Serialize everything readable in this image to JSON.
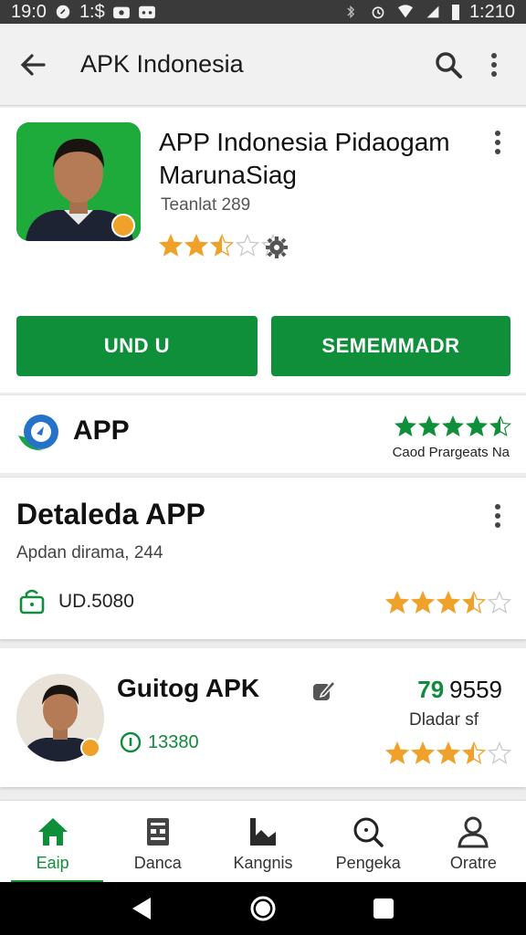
{
  "status_bar": {
    "left_time": "19:0",
    "left_extra": "1:$",
    "right_time": "1:210"
  },
  "app_bar": {
    "title": "APK Indonesia",
    "icons": [
      "back-arrow-icon",
      "search-icon",
      "more-vert-icon"
    ]
  },
  "header": {
    "app_title": "APP Indonesia Pidaogam MarunaSiag",
    "subtitle": "Teanlat 289",
    "rating": 2.5,
    "install_label": "UND U",
    "secondary_label": "SEMEMMADR"
  },
  "app_row": {
    "label": "APP",
    "rating": 4.5,
    "caption": "Caod Prargeats Na"
  },
  "details": {
    "title": "Detaleda APP",
    "subtitle": "Apdan dirama, 244",
    "price": "UD.5080",
    "rating": 3.5
  },
  "listing": {
    "name": "Guitog APK",
    "downloads": "13380",
    "metric_value": "79",
    "metric_suffix": "9559",
    "metric_label": "Dladar sf",
    "rating": 3.5
  },
  "bottom_nav": [
    {
      "label": "Eaip",
      "icon": "home-icon",
      "active": true
    },
    {
      "label": "Danca",
      "icon": "apps-icon",
      "active": false
    },
    {
      "label": "Kangnis",
      "icon": "chart-icon",
      "active": false
    },
    {
      "label": "Pengeka",
      "icon": "search-icon",
      "active": false
    },
    {
      "label": "Oratre",
      "icon": "person-icon",
      "active": false
    }
  ],
  "colors": {
    "accent": "#0f8f3a",
    "star": "#f0a12a",
    "status_bar": "#3a3a3a"
  }
}
